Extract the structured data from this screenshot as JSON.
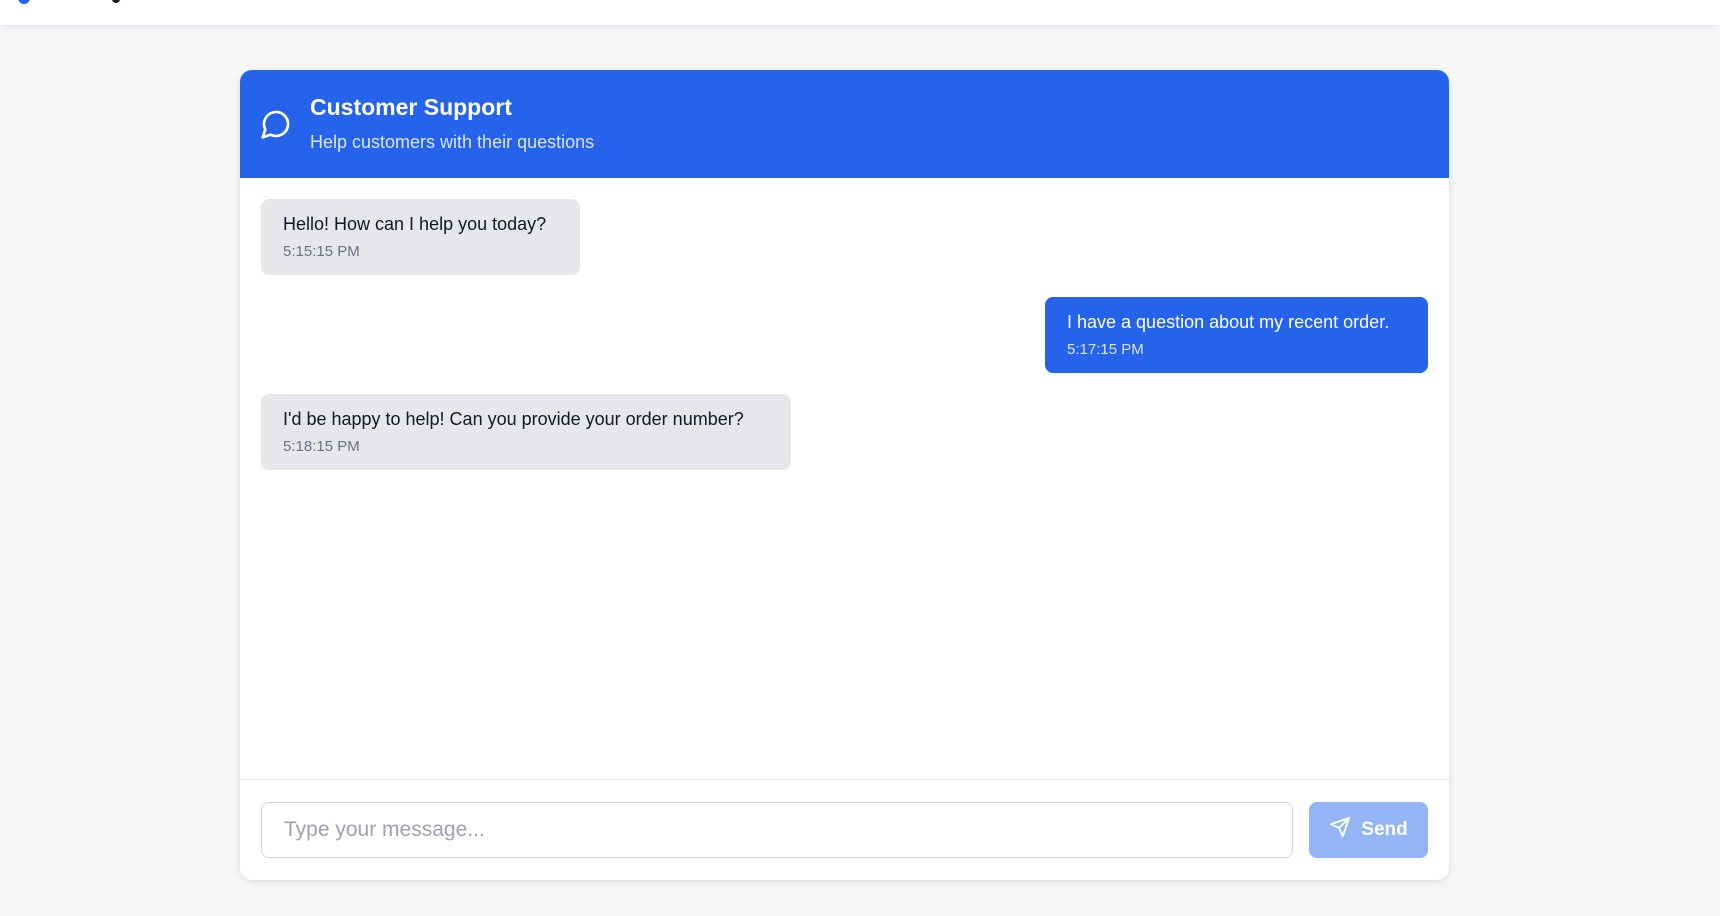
{
  "header": {
    "title": "Customer Support",
    "subtitle": "Help customers with their questions",
    "icon": "chat-bubble-icon"
  },
  "messages": [
    {
      "sender": "agent",
      "text": "Hello! How can I help you today?",
      "time": "5:15:15 PM"
    },
    {
      "sender": "user",
      "text": "I have a question about my recent order.",
      "time": "5:17:15 PM"
    },
    {
      "sender": "agent",
      "text": "I'd be happy to help! Can you provide your order number?",
      "time": "5:18:15 PM"
    }
  ],
  "composer": {
    "placeholder": "Type your message...",
    "value": "",
    "send_label": "Send",
    "send_icon": "send-icon"
  },
  "colors": {
    "accent": "#2563eb",
    "incoming_bubble": "#e5e7eb",
    "send_button_disabled": "#93b4f5",
    "page_background": "#f6f7f9"
  }
}
